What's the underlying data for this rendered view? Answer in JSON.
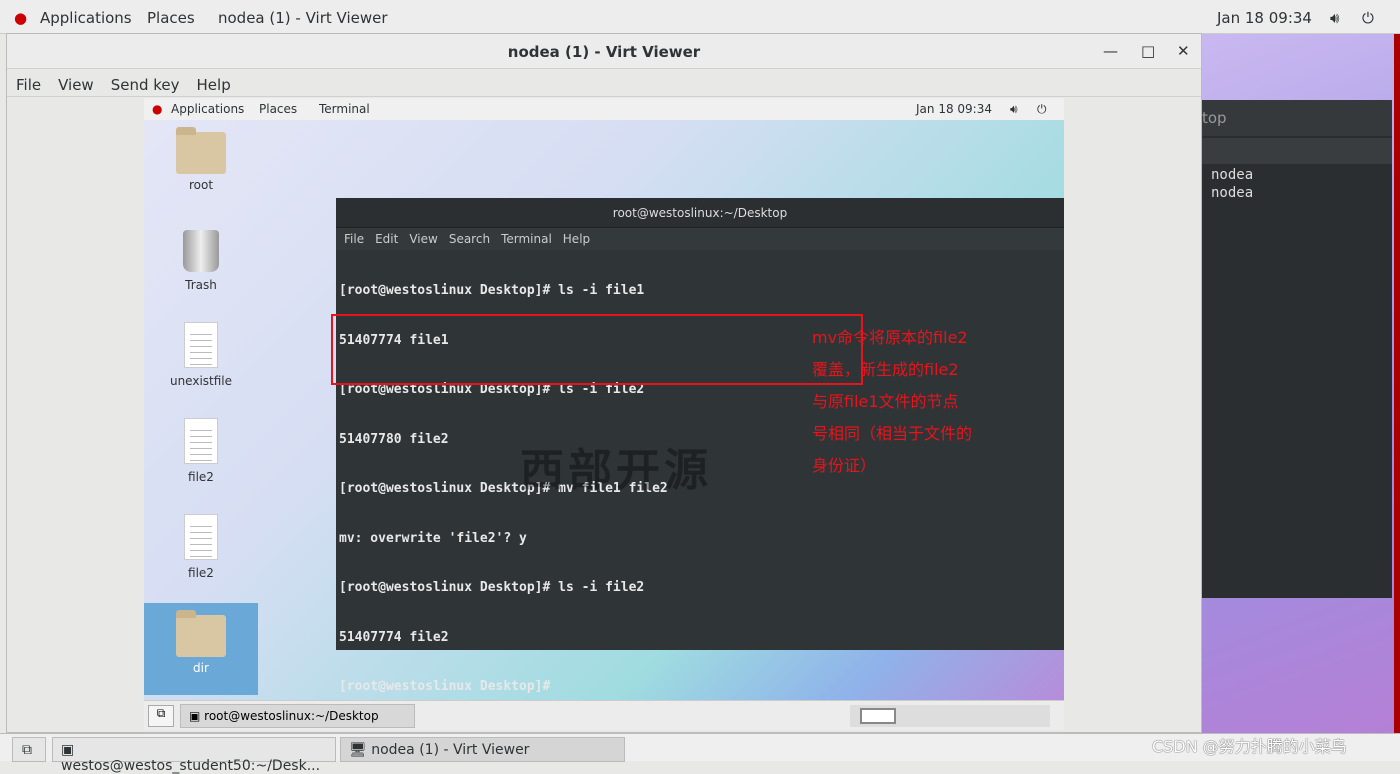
{
  "host_topbar": {
    "applications": "Applications",
    "places": "Places",
    "window": "nodea (1) - Virt Viewer",
    "clock": "Jan 18  09:34",
    "volume_icon": "speaker-icon",
    "power_icon": "power-icon"
  },
  "virt_viewer": {
    "title": "nodea (1) - Virt Viewer",
    "menu": [
      "File",
      "View",
      "Send key",
      "Help"
    ]
  },
  "guest": {
    "topbar": {
      "applications": "Applications",
      "places": "Places",
      "terminal": "Terminal",
      "clock": "Jan 18  09:34"
    },
    "desktop_icons": [
      "root",
      "Trash",
      "unexistfile",
      "file2",
      "file2",
      "dir"
    ],
    "terminal": {
      "title": "root@westoslinux:~/Desktop",
      "menu": [
        "File",
        "Edit",
        "View",
        "Search",
        "Terminal",
        "Help"
      ],
      "lines": [
        "[root@westoslinux Desktop]# ls -i file1",
        "51407774 file1",
        "[root@westoslinux Desktop]# ls -i file2",
        "51407780 file2",
        "[root@westoslinux Desktop]# mv file1 file2",
        "mv: overwrite 'file2'? y",
        "[root@westoslinux Desktop]# ls -i file2",
        "51407774 file2",
        "[root@westoslinux Desktop]# "
      ]
    },
    "watermark": "西部开源",
    "taskbar_item": "root@westoslinux:~/Desktop"
  },
  "annotation": [
    "mv命令将原本的file2",
    "覆盖，新生成的file2",
    "与原file1文件的节点",
    "号相同（相当于文件的",
    "身份证）"
  ],
  "background_terminal": {
    "title_fragment": "top",
    "lines": [
      "nodea",
      "nodea"
    ]
  },
  "host_taskbar": [
    "westos@westos_student50:~/Desk...",
    "nodea (1) - Virt Viewer"
  ],
  "watermark_csdn": "CSDN @努力扑腾的小菜鸟",
  "colors": {
    "annotation": "#e8141b",
    "terminal_bg": "#2f3437"
  }
}
